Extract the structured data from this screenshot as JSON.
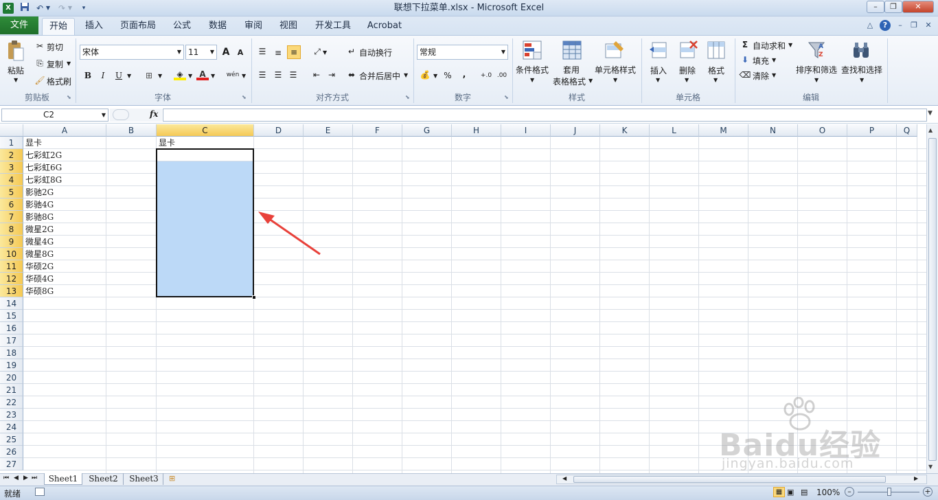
{
  "window": {
    "title": "联想下拉菜单.xlsx - Microsoft Excel",
    "qat": {
      "save_icon": "save-icon",
      "undo_icon": "undo-icon",
      "redo_icon": "redo-icon"
    }
  },
  "tabs": {
    "file": "文件",
    "items": [
      "开始",
      "插入",
      "页面布局",
      "公式",
      "数据",
      "审阅",
      "视图",
      "开发工具",
      "Acrobat"
    ],
    "active": "开始"
  },
  "ribbon": {
    "clipboard": {
      "paste": "粘贴",
      "cut": "剪切",
      "copy": "复制",
      "format_painter": "格式刷",
      "label": "剪贴板"
    },
    "font": {
      "name": "宋体",
      "size": "11",
      "bold": "B",
      "italic": "I",
      "underline": "U",
      "label": "字体",
      "grow": "A",
      "shrink": "A",
      "wen": "wén"
    },
    "alignment": {
      "wrap": "自动换行",
      "merge": "合并后居中",
      "label": "对齐方式"
    },
    "number": {
      "format": "常规",
      "percent": "%",
      "comma": ",",
      "label": "数字",
      "inc_dec": "+.0",
      "dec_dec": ".00"
    },
    "styles": {
      "conditional": "条件格式",
      "table1": "套用",
      "table2": "表格格式",
      "cell_styles": "单元格样式",
      "label": "样式"
    },
    "cells": {
      "insert": "插入",
      "delete": "删除",
      "format": "格式",
      "label": "单元格"
    },
    "editing": {
      "autosum": "自动求和",
      "fill": "填充",
      "clear": "清除",
      "sort": "排序和筛选",
      "find": "查找和选择",
      "label": "编辑",
      "sigma": "Σ"
    }
  },
  "formula_bar": {
    "name_box": "C2",
    "fx": "fx",
    "content": ""
  },
  "grid": {
    "columns": [
      "A",
      "B",
      "C",
      "D",
      "E",
      "F",
      "G",
      "H",
      "I",
      "J",
      "K",
      "L",
      "M",
      "N",
      "O",
      "P",
      "Q"
    ],
    "rows": [
      "1",
      "2",
      "3",
      "4",
      "5",
      "6",
      "7",
      "8",
      "9",
      "10",
      "11",
      "12",
      "13",
      "14",
      "15",
      "16",
      "17",
      "18",
      "19",
      "20",
      "21",
      "22",
      "23",
      "24",
      "25",
      "26",
      "27"
    ],
    "colA": [
      "显卡",
      "七彩虹2G",
      "七彩虹6G",
      "七彩虹8G",
      "影驰2G",
      "影驰4G",
      "影驰8G",
      "微星2G",
      "微星4G",
      "微星8G",
      "华硕2G",
      "华硕4G",
      "华硕8G"
    ],
    "colC": [
      "显卡"
    ],
    "selection": {
      "active_cell": "C2",
      "range": "C2:C13",
      "fill_color": "#bcd9f7"
    },
    "arrow_color": "#e8413a"
  },
  "sheets": {
    "tabs": [
      "Sheet1",
      "Sheet2",
      "Sheet3"
    ],
    "active": "Sheet1"
  },
  "status": {
    "ready": "就绪",
    "zoom": "100%"
  },
  "watermark": {
    "brand": "Baidu经验",
    "url": "jingyan.baidu.com"
  }
}
